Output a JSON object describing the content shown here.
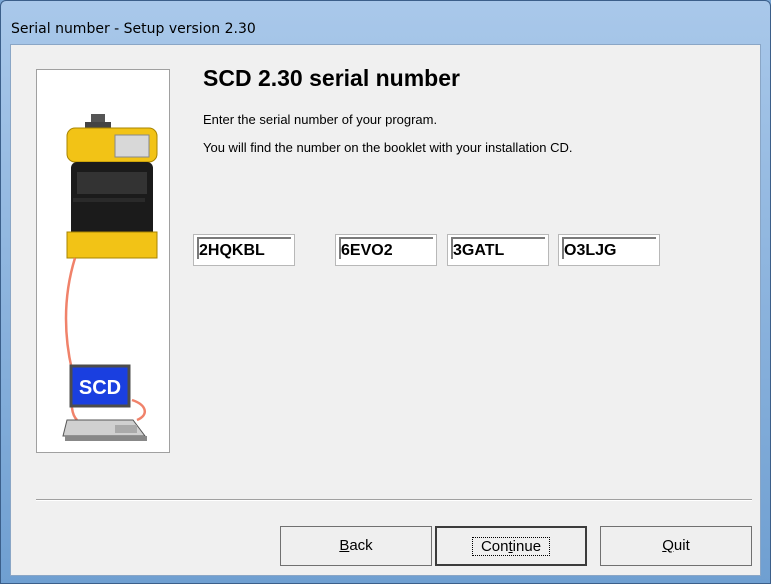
{
  "window": {
    "title": "Serial number - Setup version 2.30"
  },
  "main": {
    "heading": "SCD 2.30 serial number",
    "desc1": "Enter the serial number of your program.",
    "desc2": "You will find the number on the booklet with your installation CD.",
    "serial_fields": [
      "2HQKBL",
      "6EVO2",
      "3GATL",
      "O3LJG"
    ],
    "icon_label": "SCD"
  },
  "buttons": {
    "back": {
      "mnemonic": "B",
      "rest": "ack"
    },
    "continue": {
      "prefix": "Con",
      "mnemonic": "t",
      "rest": "inue"
    },
    "quit": {
      "mnemonic": "Q",
      "rest": "uit"
    }
  }
}
